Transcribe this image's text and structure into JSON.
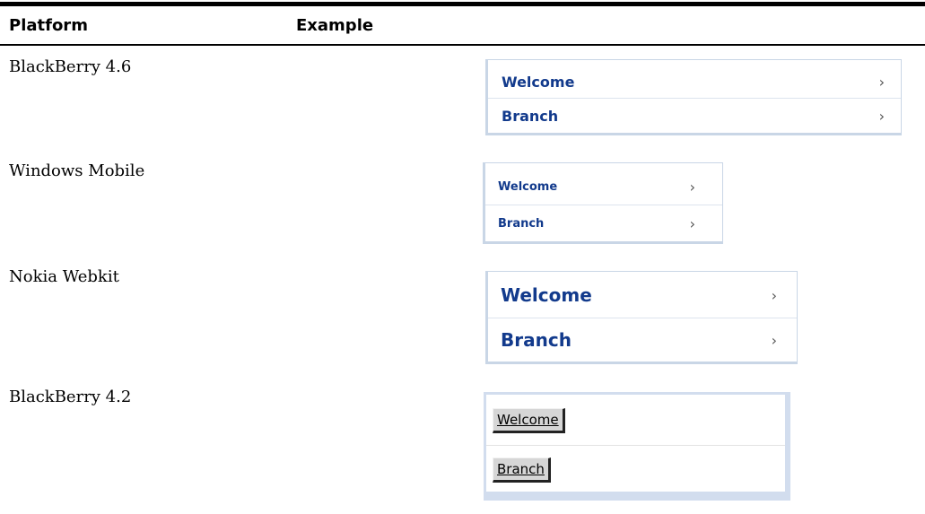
{
  "table": {
    "headers": {
      "platform": "Platform",
      "example": "Example"
    },
    "rows": [
      {
        "platform": "BlackBerry 4.6",
        "items": [
          {
            "label": "Welcome",
            "chevron": "›"
          },
          {
            "label": "Branch",
            "chevron": "›"
          }
        ]
      },
      {
        "platform": "Windows Mobile",
        "items": [
          {
            "label": "Welcome",
            "chevron": "›"
          },
          {
            "label": "Branch",
            "chevron": "›"
          }
        ]
      },
      {
        "platform": "Nokia Webkit",
        "items": [
          {
            "label": "Welcome",
            "chevron": "›"
          },
          {
            "label": "Branch",
            "chevron": "›"
          }
        ]
      },
      {
        "platform": "BlackBerry 4.2",
        "items": [
          {
            "label": "Welcome"
          },
          {
            "label": "Branch"
          }
        ]
      }
    ]
  },
  "colors": {
    "link_text": "#123a8c",
    "panel_border": "#c9d6e6",
    "bb42_frame": "#d2ddee",
    "bb42_button": "#d6d6d6"
  }
}
